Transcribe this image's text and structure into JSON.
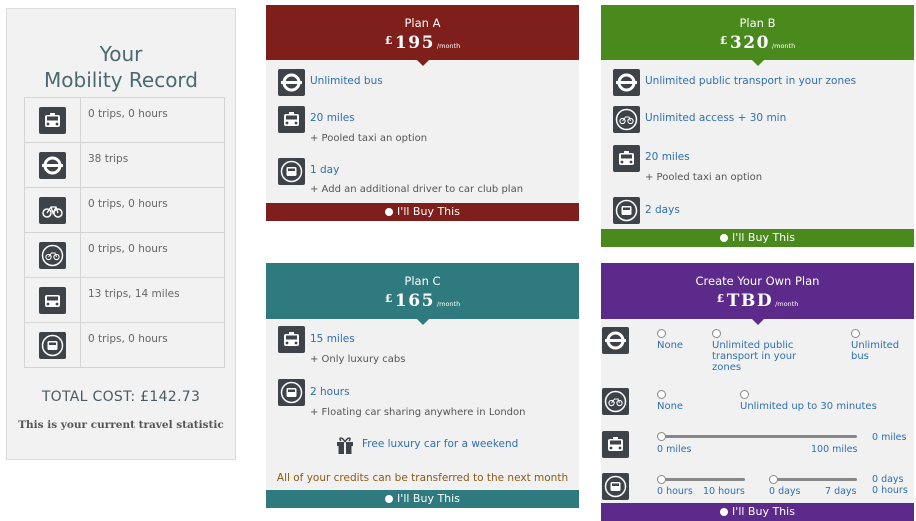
{
  "record": {
    "title_line1": "Your",
    "title_line2": "Mobility Record",
    "rows": [
      {
        "icon": "taxi-icon",
        "value": "0 trips, 0 hours"
      },
      {
        "icon": "underground-roundel-icon",
        "value": "38 trips"
      },
      {
        "icon": "bicycle-icon",
        "value": "0 trips, 0 hours"
      },
      {
        "icon": "bike-share-icon",
        "value": "0 trips, 0 hours"
      },
      {
        "icon": "car-icon",
        "value": "13 trips, 14 miles"
      },
      {
        "icon": "car-club-icon",
        "value": "0 trips, 0 hours"
      }
    ],
    "total": "TOTAL COST: £142.73",
    "note": "This is your current travel statistic"
  },
  "plans": {
    "a": {
      "name": "Plan A",
      "currency": "£",
      "price": "195",
      "period": "/month",
      "color": "#7f1f1b",
      "features": [
        {
          "icon": "underground-roundel-icon",
          "label": "Unlimited bus",
          "sub": ""
        },
        {
          "icon": "taxi-icon",
          "label": "20 miles",
          "sub": "+ Pooled taxi an option"
        },
        {
          "icon": "car-club-icon",
          "label": "1 day",
          "sub": "+ Add an additional driver to car club plan"
        }
      ],
      "buy": "I'll Buy This"
    },
    "b": {
      "name": "Plan B",
      "currency": "£",
      "price": "320",
      "period": "/month",
      "color": "#4a8a1c",
      "features": [
        {
          "icon": "underground-roundel-icon",
          "label": "Unlimited public transport in your zones",
          "sub": ""
        },
        {
          "icon": "bike-share-icon",
          "label": "Unlimited access + 30 min",
          "sub": ""
        },
        {
          "icon": "taxi-icon",
          "label": "20 miles",
          "sub": "+ Pooled taxi an option"
        },
        {
          "icon": "car-club-icon",
          "label": "2 days",
          "sub": ""
        }
      ],
      "buy": "I'll Buy This"
    },
    "c": {
      "name": "Plan C",
      "currency": "£",
      "price": "165",
      "period": "/month",
      "color": "#2f7a7e",
      "features": [
        {
          "icon": "taxi-icon",
          "label": "15 miles",
          "sub": "+ Only luxury cabs"
        },
        {
          "icon": "car-club-icon",
          "label": "2 hours",
          "sub": "+ Floating car sharing anywhere in London"
        }
      ],
      "bonus": "Free luxury car for a weekend",
      "bonus_icon": "gift-icon",
      "credits": "All of your credits can be transferred to the next month",
      "buy": "I'll Buy This"
    },
    "custom": {
      "name": "Create Your Own Plan",
      "currency": "£",
      "price": "TBD",
      "period": "/month",
      "color": "#5b2a8a",
      "transport_options": [
        "None",
        "Unlimited public transport in your zones",
        "Unlimited bus"
      ],
      "bike_options": [
        "None",
        "Unlimited up to 30 minutes"
      ],
      "taxi": {
        "value": "0 miles",
        "min": "0 miles",
        "max": "100 miles"
      },
      "carclub": {
        "hours_value": "",
        "hours_min": "0 hours",
        "hours_max": "10 hours",
        "days_min": "0 days",
        "days_max": "7 days",
        "days_value": "0 days",
        "hours_readout": "0 hours"
      },
      "buy": "I'll Buy This"
    }
  },
  "colors": {
    "link": "#2f6fb3",
    "tile": "#3e4349"
  }
}
